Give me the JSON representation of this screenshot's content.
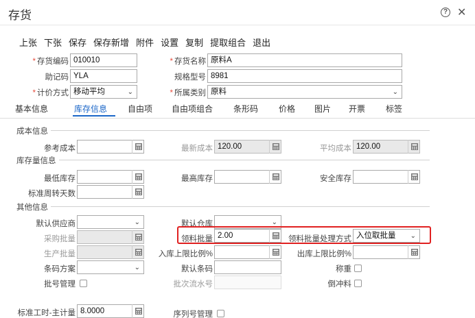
{
  "window": {
    "title": "存货",
    "help_glyph": "?",
    "close_glyph": "✕"
  },
  "toolbar": [
    "上张",
    "下张",
    "保存",
    "保存新增",
    "附件",
    "设置",
    "复制",
    "提取组合",
    "退出"
  ],
  "header_fields": {
    "code_label": "存货编码",
    "code_value": "010010",
    "name_label": "存货名称",
    "name_value": "原料A",
    "mnemonic_label": "助记码",
    "mnemonic_value": "YLA",
    "spec_label": "规格型号",
    "spec_value": "8981",
    "pricing_label": "计价方式",
    "pricing_value": "移动平均",
    "category_label": "所属类别",
    "category_value": "原料"
  },
  "tabs": [
    "基本信息",
    "库存信息",
    "自由项",
    "自由项组合",
    "条形码",
    "价格",
    "图片",
    "开票",
    "标签"
  ],
  "active_tab": "库存信息",
  "cost": {
    "section": "成本信息",
    "ref_label": "参考成本",
    "ref_value": "",
    "latest_label": "最新成本",
    "latest_value": "120.00",
    "avg_label": "平均成本",
    "avg_value": "120.00"
  },
  "stock": {
    "section": "库存量信息",
    "min_label": "最低库存",
    "min_value": "",
    "max_label": "最高库存",
    "max_value": "",
    "safe_label": "安全库存",
    "safe_value": "",
    "turnover_label": "标准周转天数",
    "turnover_value": ""
  },
  "other": {
    "section": "其他信息",
    "supplier_label": "默认供应商",
    "supplier_value": "",
    "warehouse_label": "默认仓库",
    "warehouse_value": "",
    "purchase_batch_label": "采购批量",
    "purchase_batch_value": "",
    "pick_batch_label": "领料批量",
    "pick_batch_value": "2.00",
    "pick_mode_label": "领料批量处理方式",
    "pick_mode_value": "入位取批量",
    "prod_batch_label": "生产批量",
    "prod_batch_value": "",
    "in_ratio_label": "入库上限比例%",
    "in_ratio_value": "",
    "out_ratio_label": "出库上限比例%",
    "out_ratio_value": "",
    "barcode_scheme_label": "条码方案",
    "barcode_scheme_value": "",
    "default_barcode_label": "默认条码",
    "default_barcode_value": "",
    "weigh_label": "称重",
    "batch_mgmt_label": "批号管理",
    "batch_serial_label": "批次流水号",
    "batch_serial_value": "",
    "backflush_label": "倒冲料",
    "std_hours_label": "标准工时-主计量",
    "std_hours_value": "8.0000",
    "serial_mgmt_label": "序列号管理"
  }
}
